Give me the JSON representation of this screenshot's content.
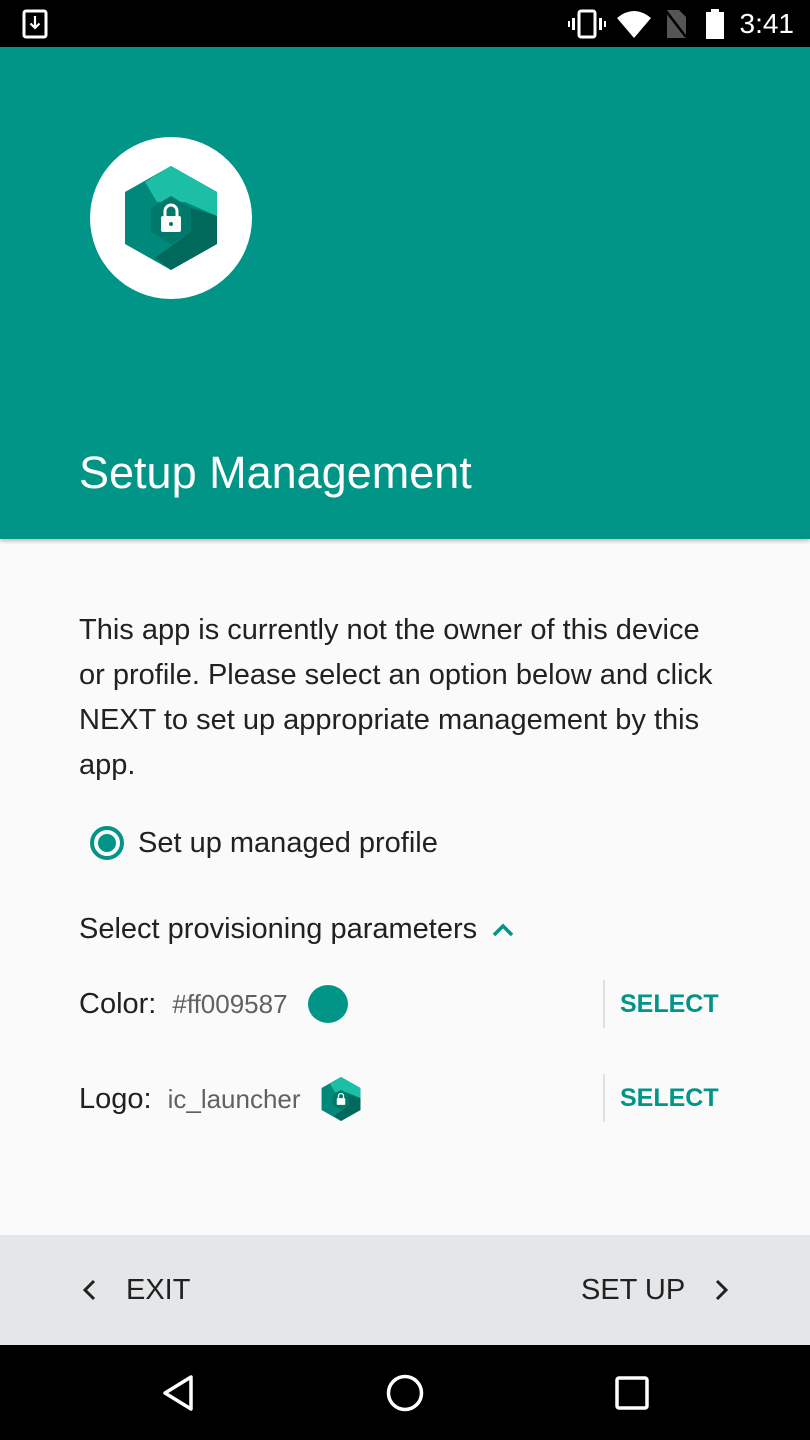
{
  "status_bar": {
    "time": "3:41",
    "icons": [
      "download-notification-icon",
      "vibrate-icon",
      "wifi-icon",
      "no-sim-icon",
      "battery-icon"
    ]
  },
  "header": {
    "title": "Setup Management",
    "background_color": "#009587",
    "logo_icon": "app-logo-hexagon-lock-icon"
  },
  "content": {
    "description": "This app is currently not the owner of this device or profile. Please select an option below and click NEXT to set up appropriate management by this app.",
    "radio_option": {
      "label": "Set up managed profile",
      "selected": true
    },
    "params_header": {
      "label": "Select provisioning parameters",
      "expanded": true
    },
    "params": [
      {
        "label": "Color:",
        "value": "#ff009587",
        "preview": "color-swatch",
        "swatch_color": "#009587",
        "action": "SELECT"
      },
      {
        "label": "Logo:",
        "value": "ic_launcher",
        "preview": "logo-preview",
        "action": "SELECT"
      }
    ],
    "accent_color": "#009587"
  },
  "footer": {
    "exit_label": "EXIT",
    "setup_label": "SET UP"
  },
  "nav_bar": {
    "buttons": [
      "back",
      "home",
      "recents"
    ]
  }
}
